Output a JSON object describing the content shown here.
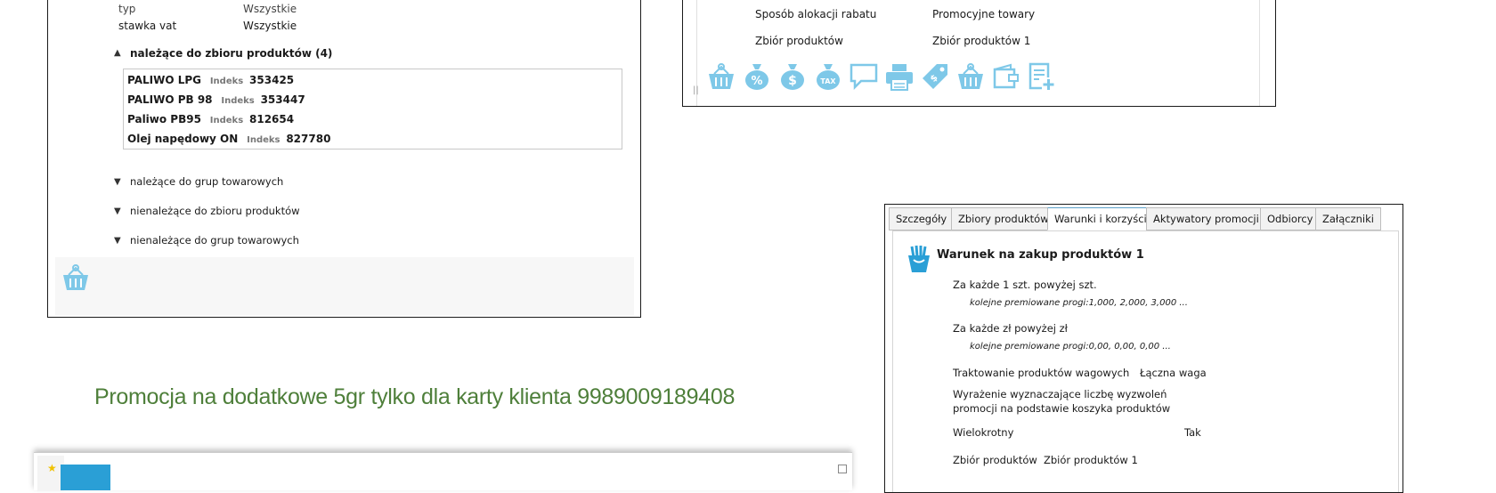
{
  "left_panel": {
    "rows": [
      {
        "label": "typ",
        "value": "Wszystkie"
      },
      {
        "label": "stawka vat",
        "value": "Wszystkie"
      }
    ],
    "expanded_section": {
      "label": "należące do zbioru produktów (4)"
    },
    "index_label": "Indeks",
    "products": [
      {
        "name": "PALIWO LPG",
        "index": "353425"
      },
      {
        "name": "PALIWO PB 98",
        "index": "353447"
      },
      {
        "name": "Paliwo PB95",
        "index": "812654"
      },
      {
        "name": "Olej napędowy ON",
        "index": "827780"
      }
    ],
    "collapsed_sections": [
      "należące do grup towarowych",
      "nienależące do zbioru produktów",
      "nienależące do grup towarowych"
    ],
    "icon": "basket-icon"
  },
  "right_top_panel": {
    "rows": [
      {
        "label": "Sposób alokacji rabatu",
        "value": "Promocyjne towary"
      },
      {
        "label": "Zbiór produktów",
        "value": "Zbiór produktów 1"
      }
    ],
    "icons": [
      "basket-icon",
      "money-bag-percent-icon",
      "money-bag-dollar-icon",
      "money-bag-tax-icon",
      "chat-bubble-icon",
      "printer-icon",
      "price-tag-icon",
      "basket-icon",
      "wallet-icon",
      "document-add-icon"
    ]
  },
  "heading": "Promocja na dodatkowe 5gr tylko dla karty klienta 9989009189408",
  "right_panel": {
    "tabs": [
      "Szczegóły",
      "Zbiory produktów",
      "Warunki i korzyści",
      "Aktywatory promocji",
      "Odbiorcy",
      "Załączniki"
    ],
    "active_tab": "Warunki i korzyści",
    "condition_title": "Warunek na zakup produktów 1",
    "line1": "Za każde 1 szt. powyżej  szt.",
    "line1_sub": "kolejne premiowane progi:1,000, 2,000, 3,000 ...",
    "line2": "Za każde  zł powyżej  zł",
    "line2_sub": "kolejne premiowane progi:0,00, 0,00, 0,00 ...",
    "weight_label": "Traktowanie produktów wagowych",
    "weight_value": "Łączna waga",
    "expression_line1": "Wyrażenie wyznaczające liczbę wyzwoleń",
    "expression_line2": "promocji na podstawie koszyka produktów",
    "multi_label": "Wielokrotny",
    "multi_value": "Tak",
    "set_label": "Zbiór produktów",
    "set_value": "Zbiór produktów 1"
  },
  "colors": {
    "icon": "#7ec8e8",
    "heading": "#4e7f3a",
    "accent": "#2a9fd6"
  }
}
